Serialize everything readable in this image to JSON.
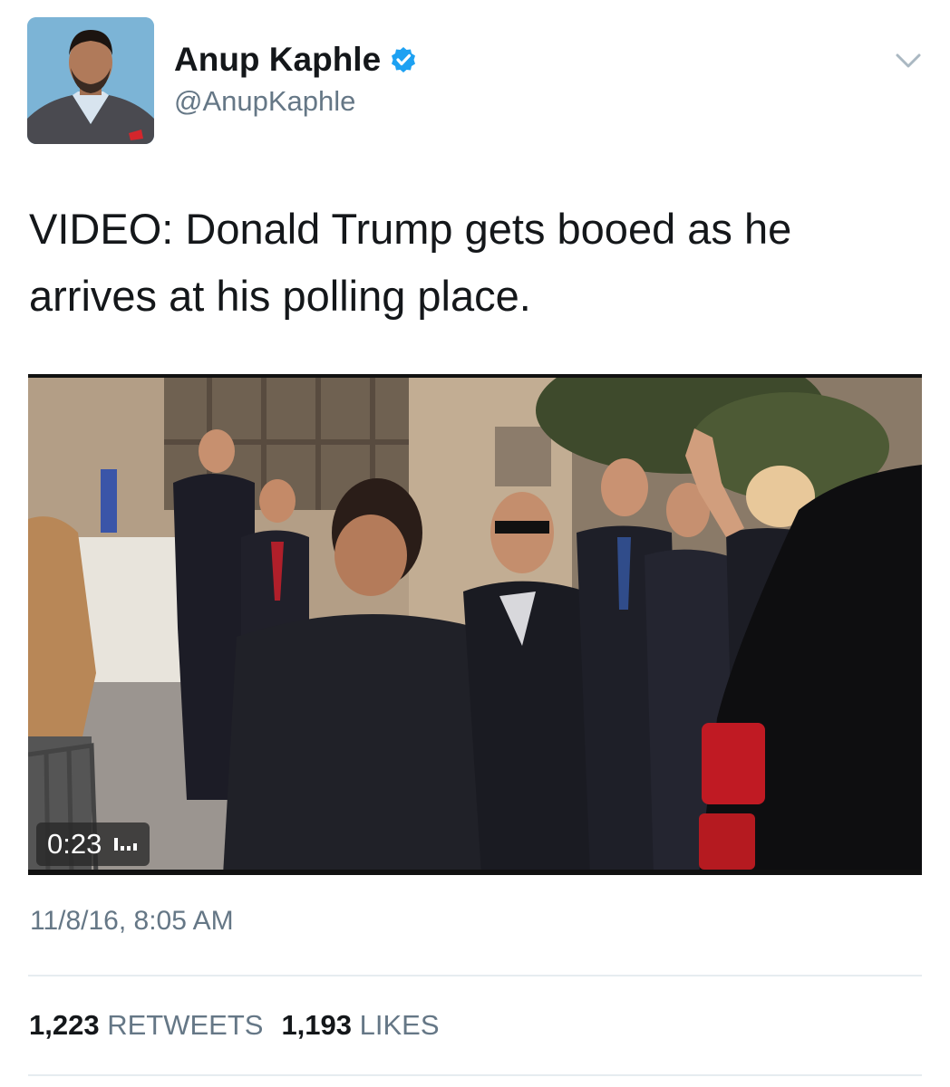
{
  "author": {
    "name": "Anup Kaphle",
    "handle": "@AnupKaphle",
    "verified": true
  },
  "tweet": {
    "text": "VIDEO: Donald Trump gets booed as he arrives at his polling place.",
    "timestamp": "11/8/16, 8:05 AM"
  },
  "video": {
    "duration": "0:23"
  },
  "stats": {
    "retweets_count": "1,223",
    "retweets_label": "RETWEETS",
    "likes_count": "1,193",
    "likes_label": "LIKES"
  },
  "icons": {
    "verified": "verified-badge-icon",
    "menu": "chevron-down-icon",
    "sound": "sound-bars-icon"
  },
  "colors": {
    "verified_blue": "#1da1f2",
    "secondary_text": "#657786",
    "primary_text": "#14171a",
    "divider": "#e6ecf0"
  }
}
